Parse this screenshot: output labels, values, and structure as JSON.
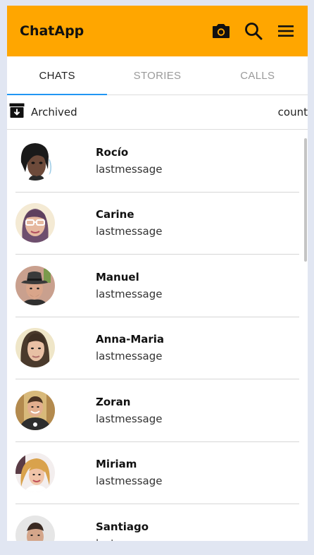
{
  "app": {
    "title": "ChatApp"
  },
  "header": {
    "icons": [
      "camera-icon",
      "search-icon",
      "menu-icon"
    ]
  },
  "tabs": [
    {
      "label": "CHATS",
      "active": true
    },
    {
      "label": "STORIES",
      "active": false
    },
    {
      "label": "CALLS",
      "active": false
    }
  ],
  "archived": {
    "label": "Archived",
    "count": "count",
    "icon": "archive-icon"
  },
  "chats": [
    {
      "name": "Rocío",
      "message": "lastmessage"
    },
    {
      "name": "Carine",
      "message": "lastmessage"
    },
    {
      "name": "Manuel",
      "message": "lastmessage"
    },
    {
      "name": "Anna-Maria",
      "message": "lastmessage"
    },
    {
      "name": "Zoran",
      "message": "lastmessage"
    },
    {
      "name": "Miriam",
      "message": "lastmessage"
    },
    {
      "name": "Santiago",
      "message": "lastmessage"
    }
  ],
  "colors": {
    "appbar": "#ffa600",
    "tab_indicator": "#2196f3",
    "background": "#e1e6f2"
  }
}
